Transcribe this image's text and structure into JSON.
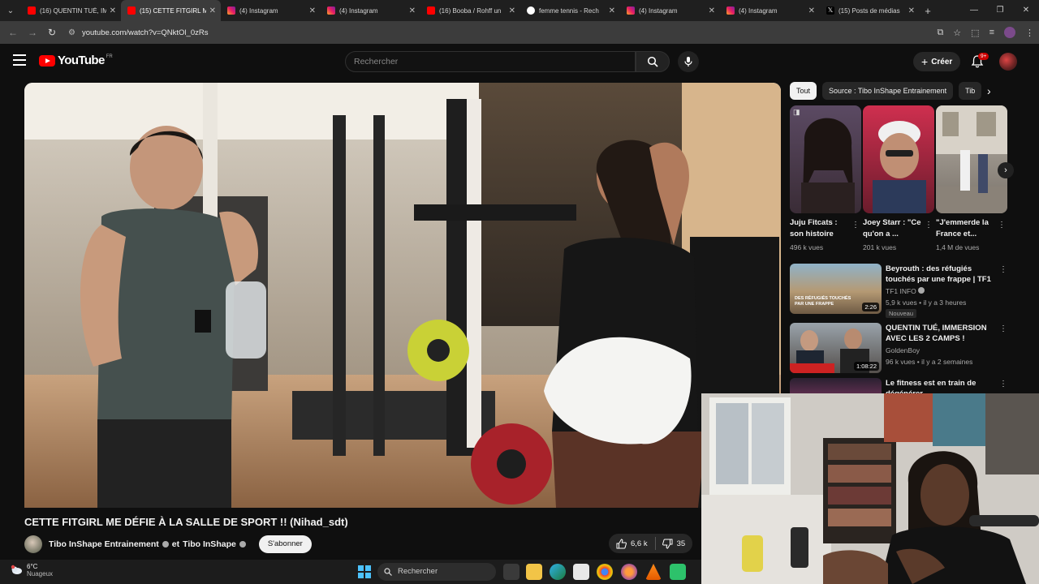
{
  "browser": {
    "tabs": [
      {
        "title": "(16) QUENTIN TUÉ, IM",
        "icon": "youtube-icon",
        "active": false
      },
      {
        "title": "(15) CETTE FITGIRL M",
        "icon": "youtube-icon",
        "active": true
      },
      {
        "title": "(4) Instagram",
        "icon": "instagram-icon",
        "active": false
      },
      {
        "title": "(4) Instagram",
        "icon": "instagram-icon",
        "active": false
      },
      {
        "title": "(16) Booba / Rohff un",
        "icon": "youtube-icon",
        "active": false
      },
      {
        "title": "femme tennis - Rech",
        "icon": "google-icon",
        "active": false
      },
      {
        "title": "(4) Instagram",
        "icon": "instagram-icon",
        "active": false
      },
      {
        "title": "(4) Instagram",
        "icon": "instagram-icon",
        "active": false
      },
      {
        "title": "(15) Posts de médias",
        "icon": "x-icon",
        "active": false
      }
    ],
    "url": "youtube.com/watch?v=QNktOl_0zRs"
  },
  "header": {
    "logo_text": "YouTube",
    "logo_region": "FR",
    "search_placeholder": "Rechercher",
    "create_label": "Créer",
    "notif_count": "9+"
  },
  "video": {
    "title": "CETTE FITGIRL ME DÉFIE À LA SALLE DE SPORT !! (Nihad_sdt)",
    "channel": "Tibo InShape Entrainement",
    "channel_join": "et",
    "channel2": "Tibo InShape",
    "subscribe_label": "S'abonner",
    "likes": "6,6 k",
    "dislikes": "35"
  },
  "chips": [
    {
      "label": "Tout",
      "active": true
    },
    {
      "label": "Source : Tibo InShape Entrainement",
      "active": false
    },
    {
      "label": "Tib",
      "active": false
    }
  ],
  "shorts": [
    {
      "title": "Juju Fitcats : son histoire",
      "views": "496 k vues"
    },
    {
      "title": "Joey Starr : \"Ce qu'on a ...",
      "views": "201 k vues"
    },
    {
      "title": "\"J'emmerde la France et...",
      "views": "1,4 M de vues"
    }
  ],
  "recommendations": [
    {
      "title": "Beyrouth : des réfugiés touchés par une frappe | TF1 INFO",
      "channel": "TF1 INFO",
      "meta": "5,9 k vues • il y a 3 heures",
      "duration": "2:26",
      "badge": "Nouveau",
      "thumb_text": "DES RÉFUGIÉS TOUCHÉS PAR UNE FRAPPE"
    },
    {
      "title": "QUENTIN TUÉ, IMMERSION AVEC LES 2 CAMPS !",
      "channel": "GoldenBoy",
      "meta": "96 k vues • il y a 2 semaines",
      "duration": "1:08:22",
      "badge": "",
      "thumb_text": ""
    },
    {
      "title": "Le fitness est en train de dégénérer",
      "channel": "",
      "meta": "",
      "duration": "",
      "badge": "",
      "thumb_text": ""
    }
  ],
  "taskbar": {
    "temperature": "6°C",
    "weather": "Nuageux",
    "search_label": "Rechercher"
  },
  "colors": {
    "youtube_red": "#ff0000",
    "background": "#0f0f0f",
    "notif_badge": "#cc0000"
  }
}
